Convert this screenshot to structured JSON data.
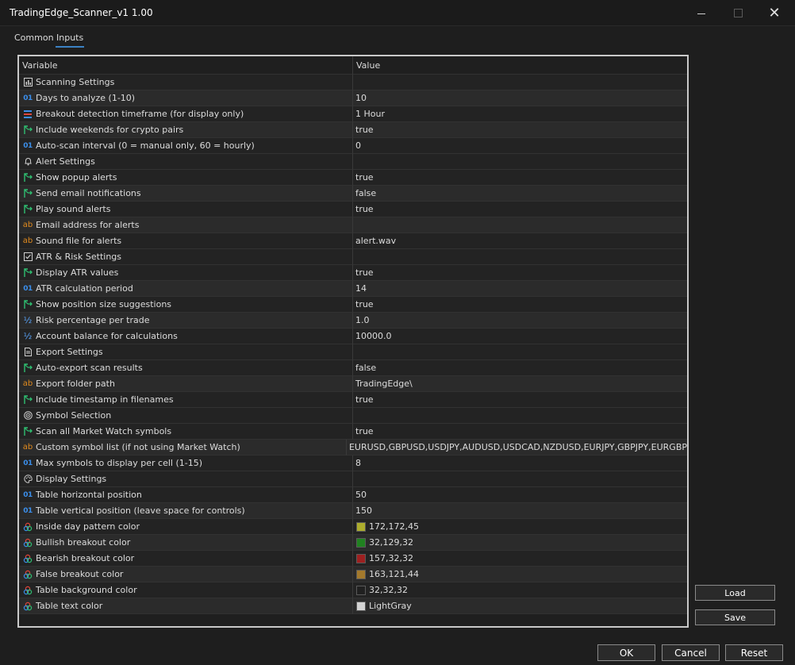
{
  "window": {
    "title": "TradingEdge_Scanner_v1 1.00"
  },
  "tabs": [
    {
      "label": "Common"
    },
    {
      "label": "Inputs"
    }
  ],
  "grid": {
    "header": {
      "variable": "Variable",
      "value": "Value"
    },
    "rows": [
      {
        "kind": "section",
        "icon": "chart-icon",
        "label": "Scanning Settings",
        "value": ""
      },
      {
        "kind": "int",
        "icon": "integer-icon",
        "label": "Days to analyze (1-10)",
        "value": "10"
      },
      {
        "kind": "enum",
        "icon": "enum-icon",
        "label": "Breakout detection timeframe (for display only)",
        "value": "1 Hour"
      },
      {
        "kind": "bool",
        "icon": "boolean-icon",
        "label": "Include weekends for crypto pairs",
        "value": "true"
      },
      {
        "kind": "int",
        "icon": "integer-icon",
        "label": "Auto-scan interval (0 = manual only, 60 = hourly)",
        "value": "0"
      },
      {
        "kind": "section",
        "icon": "bell-icon",
        "label": "Alert Settings",
        "value": ""
      },
      {
        "kind": "bool",
        "icon": "boolean-icon",
        "label": "Show popup alerts",
        "value": "true"
      },
      {
        "kind": "bool",
        "icon": "boolean-icon",
        "label": "Send email notifications",
        "value": "false"
      },
      {
        "kind": "bool",
        "icon": "boolean-icon",
        "label": "Play sound alerts",
        "value": "true"
      },
      {
        "kind": "string",
        "icon": "string-icon",
        "label": "Email address for alerts",
        "value": ""
      },
      {
        "kind": "string",
        "icon": "string-icon",
        "label": "Sound file for alerts",
        "value": "alert.wav"
      },
      {
        "kind": "section",
        "icon": "checkbox-icon",
        "label": "ATR & Risk Settings",
        "value": ""
      },
      {
        "kind": "bool",
        "icon": "boolean-icon",
        "label": "Display ATR values",
        "value": "true"
      },
      {
        "kind": "int",
        "icon": "integer-icon",
        "label": "ATR calculation period",
        "value": "14"
      },
      {
        "kind": "bool",
        "icon": "boolean-icon",
        "label": "Show position size suggestions",
        "value": "true"
      },
      {
        "kind": "double",
        "icon": "fraction-icon",
        "label": "Risk percentage per trade",
        "value": "1.0"
      },
      {
        "kind": "double",
        "icon": "fraction-icon",
        "label": "Account balance for calculations",
        "value": "10000.0"
      },
      {
        "kind": "section",
        "icon": "document-icon",
        "label": "Export Settings",
        "value": ""
      },
      {
        "kind": "bool",
        "icon": "boolean-icon",
        "label": "Auto-export scan results",
        "value": "false"
      },
      {
        "kind": "string",
        "icon": "string-icon",
        "label": "Export folder path",
        "value": "TradingEdge\\"
      },
      {
        "kind": "bool",
        "icon": "boolean-icon",
        "label": "Include timestamp in filenames",
        "value": "true"
      },
      {
        "kind": "section",
        "icon": "target-icon",
        "label": "Symbol Selection",
        "value": ""
      },
      {
        "kind": "bool",
        "icon": "boolean-icon",
        "label": "Scan all Market Watch symbols",
        "value": "true"
      },
      {
        "kind": "string",
        "icon": "string-icon",
        "label": "Custom symbol list (if not using Market Watch)",
        "value": "EURUSD,GBPUSD,USDJPY,AUDUSD,USDCAD,NZDUSD,EURJPY,GBPJPY,EURGBP"
      },
      {
        "kind": "int",
        "icon": "integer-icon",
        "label": "Max symbols to display per cell (1-15)",
        "value": "8"
      },
      {
        "kind": "section",
        "icon": "palette-icon",
        "label": "Display Settings",
        "value": ""
      },
      {
        "kind": "int",
        "icon": "integer-icon",
        "label": "Table horizontal position",
        "value": "50"
      },
      {
        "kind": "int",
        "icon": "integer-icon",
        "label": "Table vertical position (leave space for controls)",
        "value": "150"
      },
      {
        "kind": "color",
        "icon": "color-icon",
        "label": "Inside day pattern color",
        "value": "172,172,45",
        "swatch": "#acac2d"
      },
      {
        "kind": "color",
        "icon": "color-icon",
        "label": "Bullish breakout color",
        "value": "32,129,32",
        "swatch": "#208120"
      },
      {
        "kind": "color",
        "icon": "color-icon",
        "label": "Bearish breakout color",
        "value": "157,32,32",
        "swatch": "#9d2020"
      },
      {
        "kind": "color",
        "icon": "color-icon",
        "label": "False breakout color",
        "value": "163,121,44",
        "swatch": "#a3792c"
      },
      {
        "kind": "color",
        "icon": "color-icon",
        "label": "Table background color",
        "value": "32,32,32",
        "swatch": "#202020"
      },
      {
        "kind": "color",
        "icon": "color-icon",
        "label": "Table text color",
        "value": "LightGray",
        "swatch": "#d3d3d3"
      }
    ]
  },
  "side_buttons": {
    "load": "Load",
    "save": "Save"
  },
  "footer_buttons": {
    "ok": "OK",
    "cancel": "Cancel",
    "reset": "Reset"
  },
  "colors": {
    "accent": "#3b82c4",
    "background": "#1e1e1e",
    "row_even": "#2b2b2b",
    "row_odd": "#232323"
  }
}
